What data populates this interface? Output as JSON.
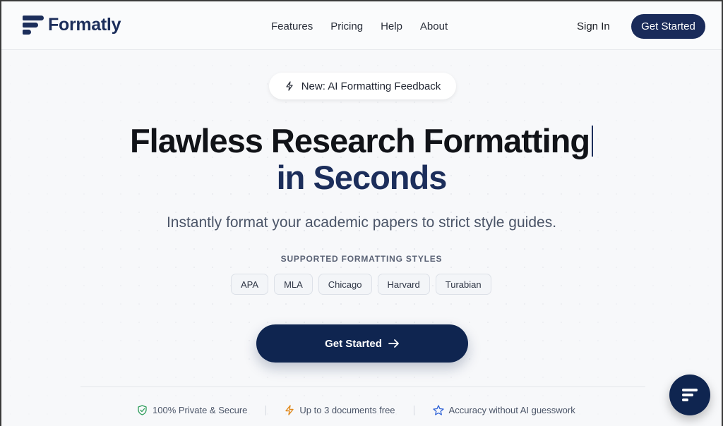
{
  "brand": {
    "name": "Formatly",
    "color": "#1c2e5b"
  },
  "nav": [
    {
      "label": "Features"
    },
    {
      "label": "Pricing"
    },
    {
      "label": "Help"
    },
    {
      "label": "About"
    }
  ],
  "header": {
    "sign_in": "Sign In",
    "get_started": "Get Started"
  },
  "announcement": {
    "icon": "bolt-icon",
    "text": "New: AI Formatting Feedback"
  },
  "hero": {
    "title_line1": "Flawless Research Formatting",
    "title_line2": "in Seconds",
    "subtitle": "Instantly format your academic papers to strict style guides."
  },
  "styles": {
    "label": "SUPPORTED FORMATTING STYLES",
    "items": [
      "APA",
      "MLA",
      "Chicago",
      "Harvard",
      "Turabian"
    ]
  },
  "cta": {
    "label": "Get Started",
    "icon": "arrow-right-icon"
  },
  "features": [
    {
      "icon": "shield-check-icon",
      "text": "100% Private & Secure",
      "color": "#2e9d5b"
    },
    {
      "icon": "lightning-icon",
      "text": "Up to 3 documents free",
      "color": "#e08a1e"
    },
    {
      "icon": "star-icon",
      "text": "Accuracy without AI guesswork",
      "color": "#2f62d6"
    }
  ],
  "chat_button": {
    "icon": "chat-logo-icon"
  },
  "colors": {
    "accent": "#0f2550",
    "background": "#f7f8fa"
  }
}
